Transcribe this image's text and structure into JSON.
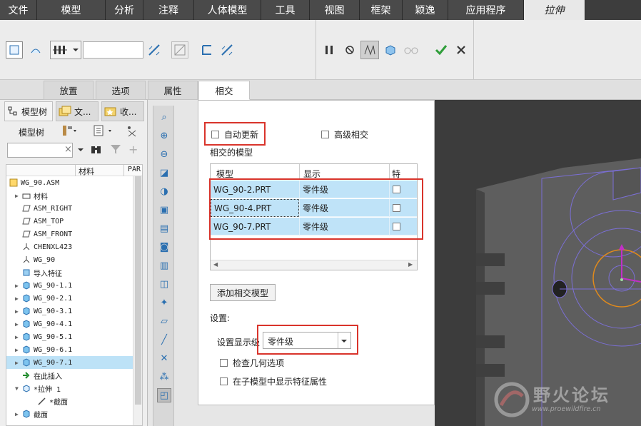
{
  "menu": {
    "tabs": [
      "文件",
      "模型",
      "分析",
      "注释",
      "人体模型",
      "工具",
      "视图",
      "框架",
      "颖逸",
      "应用程序",
      "拉伸"
    ]
  },
  "ribbon": {
    "subtabs": [
      "放置",
      "选项",
      "属性",
      "相交"
    ],
    "depth_value": ""
  },
  "left_panel": {
    "tabs": [
      "模型树",
      "文...",
      "收..."
    ],
    "title": "模型树",
    "columns": [
      "材料",
      "PAR"
    ],
    "tree": [
      {
        "label": "WG_90.ASM",
        "indent": 0,
        "icon": "asm"
      },
      {
        "label": "材料",
        "indent": 1,
        "icon": "material"
      },
      {
        "label": "ASM_RIGHT",
        "indent": 1,
        "icon": "plane"
      },
      {
        "label": "ASM_TOP",
        "indent": 1,
        "icon": "plane"
      },
      {
        "label": "ASM_FRONT",
        "indent": 1,
        "icon": "plane"
      },
      {
        "label": "CHENXL423",
        "indent": 1,
        "icon": "csys"
      },
      {
        "label": "WG_90",
        "indent": 1,
        "icon": "csys"
      },
      {
        "label": "导入特征",
        "indent": 1,
        "icon": "import"
      },
      {
        "label": "WG_90-1.1",
        "indent": 1,
        "icon": "part"
      },
      {
        "label": "WG_90-2.1",
        "indent": 1,
        "icon": "part"
      },
      {
        "label": "WG_90-3.1",
        "indent": 1,
        "icon": "part"
      },
      {
        "label": "WG_90-4.1",
        "indent": 1,
        "icon": "part"
      },
      {
        "label": "WG_90-5.1",
        "indent": 1,
        "icon": "part"
      },
      {
        "label": "WG_90-6.1",
        "indent": 1,
        "icon": "part"
      },
      {
        "label": "WG_90-7.1",
        "indent": 1,
        "icon": "part",
        "selected": true
      },
      {
        "label": "在此插入",
        "indent": 1,
        "icon": "insert"
      },
      {
        "label": "*拉伸 1",
        "indent": 1,
        "icon": "extrude"
      },
      {
        "label": "*截面",
        "indent": 2,
        "icon": "sketch"
      },
      {
        "label": "截面",
        "indent": 1,
        "icon": "section"
      }
    ]
  },
  "dialog": {
    "auto_update_label": "自动更新",
    "advanced_label": "高级相交",
    "intersected_models_label": "相交的模型",
    "table_headers": [
      "模型",
      "显示",
      "特征..."
    ],
    "rows": [
      {
        "model": "WG_90-2.PRT",
        "display": "零件级"
      },
      {
        "model": "WG_90-4.PRT",
        "display": "零件级"
      },
      {
        "model": "WG_90-7.PRT",
        "display": "零件级"
      }
    ],
    "add_button": "添加相交模型",
    "settings_label": "设置:",
    "display_level_label": "设置显示级",
    "display_level_value": "零件级",
    "check_geometry_label": "检查几何选项",
    "show_props_label": "在子模型中显示特征属性"
  },
  "watermark": {
    "text": "野火论坛",
    "url": "www.proewildfire.cn"
  }
}
